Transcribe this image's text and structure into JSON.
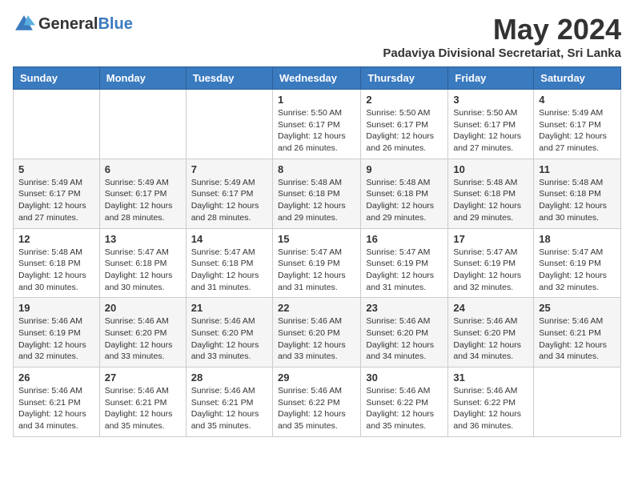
{
  "logo": {
    "text_general": "General",
    "text_blue": "Blue"
  },
  "title": "May 2024",
  "subtitle": "Padaviya Divisional Secretariat, Sri Lanka",
  "days_of_week": [
    "Sunday",
    "Monday",
    "Tuesday",
    "Wednesday",
    "Thursday",
    "Friday",
    "Saturday"
  ],
  "weeks": [
    [
      {
        "day": "",
        "info": ""
      },
      {
        "day": "",
        "info": ""
      },
      {
        "day": "",
        "info": ""
      },
      {
        "day": "1",
        "info": "Sunrise: 5:50 AM\nSunset: 6:17 PM\nDaylight: 12 hours and 26 minutes."
      },
      {
        "day": "2",
        "info": "Sunrise: 5:50 AM\nSunset: 6:17 PM\nDaylight: 12 hours and 26 minutes."
      },
      {
        "day": "3",
        "info": "Sunrise: 5:50 AM\nSunset: 6:17 PM\nDaylight: 12 hours and 27 minutes."
      },
      {
        "day": "4",
        "info": "Sunrise: 5:49 AM\nSunset: 6:17 PM\nDaylight: 12 hours and 27 minutes."
      }
    ],
    [
      {
        "day": "5",
        "info": "Sunrise: 5:49 AM\nSunset: 6:17 PM\nDaylight: 12 hours and 27 minutes."
      },
      {
        "day": "6",
        "info": "Sunrise: 5:49 AM\nSunset: 6:17 PM\nDaylight: 12 hours and 28 minutes."
      },
      {
        "day": "7",
        "info": "Sunrise: 5:49 AM\nSunset: 6:17 PM\nDaylight: 12 hours and 28 minutes."
      },
      {
        "day": "8",
        "info": "Sunrise: 5:48 AM\nSunset: 6:18 PM\nDaylight: 12 hours and 29 minutes."
      },
      {
        "day": "9",
        "info": "Sunrise: 5:48 AM\nSunset: 6:18 PM\nDaylight: 12 hours and 29 minutes."
      },
      {
        "day": "10",
        "info": "Sunrise: 5:48 AM\nSunset: 6:18 PM\nDaylight: 12 hours and 29 minutes."
      },
      {
        "day": "11",
        "info": "Sunrise: 5:48 AM\nSunset: 6:18 PM\nDaylight: 12 hours and 30 minutes."
      }
    ],
    [
      {
        "day": "12",
        "info": "Sunrise: 5:48 AM\nSunset: 6:18 PM\nDaylight: 12 hours and 30 minutes."
      },
      {
        "day": "13",
        "info": "Sunrise: 5:47 AM\nSunset: 6:18 PM\nDaylight: 12 hours and 30 minutes."
      },
      {
        "day": "14",
        "info": "Sunrise: 5:47 AM\nSunset: 6:18 PM\nDaylight: 12 hours and 31 minutes."
      },
      {
        "day": "15",
        "info": "Sunrise: 5:47 AM\nSunset: 6:19 PM\nDaylight: 12 hours and 31 minutes."
      },
      {
        "day": "16",
        "info": "Sunrise: 5:47 AM\nSunset: 6:19 PM\nDaylight: 12 hours and 31 minutes."
      },
      {
        "day": "17",
        "info": "Sunrise: 5:47 AM\nSunset: 6:19 PM\nDaylight: 12 hours and 32 minutes."
      },
      {
        "day": "18",
        "info": "Sunrise: 5:47 AM\nSunset: 6:19 PM\nDaylight: 12 hours and 32 minutes."
      }
    ],
    [
      {
        "day": "19",
        "info": "Sunrise: 5:46 AM\nSunset: 6:19 PM\nDaylight: 12 hours and 32 minutes."
      },
      {
        "day": "20",
        "info": "Sunrise: 5:46 AM\nSunset: 6:20 PM\nDaylight: 12 hours and 33 minutes."
      },
      {
        "day": "21",
        "info": "Sunrise: 5:46 AM\nSunset: 6:20 PM\nDaylight: 12 hours and 33 minutes."
      },
      {
        "day": "22",
        "info": "Sunrise: 5:46 AM\nSunset: 6:20 PM\nDaylight: 12 hours and 33 minutes."
      },
      {
        "day": "23",
        "info": "Sunrise: 5:46 AM\nSunset: 6:20 PM\nDaylight: 12 hours and 34 minutes."
      },
      {
        "day": "24",
        "info": "Sunrise: 5:46 AM\nSunset: 6:20 PM\nDaylight: 12 hours and 34 minutes."
      },
      {
        "day": "25",
        "info": "Sunrise: 5:46 AM\nSunset: 6:21 PM\nDaylight: 12 hours and 34 minutes."
      }
    ],
    [
      {
        "day": "26",
        "info": "Sunrise: 5:46 AM\nSunset: 6:21 PM\nDaylight: 12 hours and 34 minutes."
      },
      {
        "day": "27",
        "info": "Sunrise: 5:46 AM\nSunset: 6:21 PM\nDaylight: 12 hours and 35 minutes."
      },
      {
        "day": "28",
        "info": "Sunrise: 5:46 AM\nSunset: 6:21 PM\nDaylight: 12 hours and 35 minutes."
      },
      {
        "day": "29",
        "info": "Sunrise: 5:46 AM\nSunset: 6:22 PM\nDaylight: 12 hours and 35 minutes."
      },
      {
        "day": "30",
        "info": "Sunrise: 5:46 AM\nSunset: 6:22 PM\nDaylight: 12 hours and 35 minutes."
      },
      {
        "day": "31",
        "info": "Sunrise: 5:46 AM\nSunset: 6:22 PM\nDaylight: 12 hours and 36 minutes."
      },
      {
        "day": "",
        "info": ""
      }
    ]
  ]
}
